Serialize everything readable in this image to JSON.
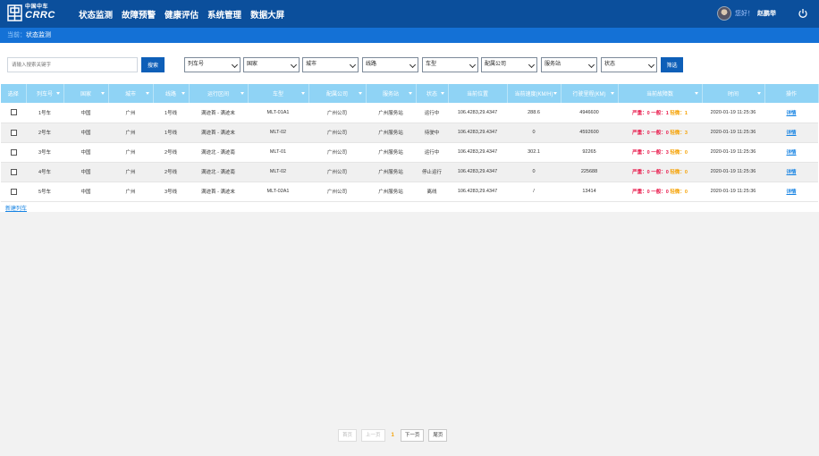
{
  "header": {
    "logo_cn": "中国中车",
    "logo_en": "CRRC",
    "nav": [
      "状态监测",
      "故障预警",
      "健康评估",
      "系统管理",
      "数据大屏"
    ],
    "greeting": "您好！",
    "username": "赵鹏举"
  },
  "breadcrumb": {
    "lead": "当前：",
    "current": "状态监测"
  },
  "toolbar": {
    "search_placeholder": "请输入搜索关键字",
    "search_label": "搜索",
    "filters": [
      "列车号",
      "国家",
      "城市",
      "线路",
      "车型",
      "配属公司",
      "服务站",
      "状态"
    ],
    "filter_label": "筛选"
  },
  "table": {
    "columns": [
      "选择",
      "列车号",
      "国家",
      "城市",
      "线路",
      "运行区间",
      "车型",
      "配属公司",
      "服务站",
      "状态",
      "当前位置",
      "当前速度(KM/H)",
      "行驶里程(KM)",
      "当前故障数",
      "时间",
      "操作"
    ],
    "fault_labels": {
      "severe": "严重：",
      "normal": "一般：",
      "minor": "轻微："
    },
    "rows": [
      {
        "train": "1号车",
        "country": "中国",
        "city": "广州",
        "line": "1号线",
        "section": "满迹首 - 满迹末",
        "model": "MLT-01A1",
        "company": "广州公司",
        "station": "广州服务站",
        "status": "运行中",
        "position": "106.4283,29.4347",
        "speed": "288.6",
        "mileage": "4946600",
        "severe": "0",
        "normal": "1",
        "minor": "1",
        "time": "2020-01-19 11:25:36",
        "action": "详情"
      },
      {
        "train": "2号车",
        "country": "中国",
        "city": "广州",
        "line": "1号线",
        "section": "满迹首 - 满迹末",
        "model": "MLT-02",
        "company": "广州公司",
        "station": "广州服务站",
        "status": "待驶中",
        "position": "106.4283,29.4347",
        "speed": "0",
        "mileage": "4592600",
        "severe": "0",
        "normal": "0",
        "minor": "3",
        "time": "2020-01-19 11:25:36",
        "action": "详情"
      },
      {
        "train": "3号车",
        "country": "中国",
        "city": "广州",
        "line": "2号线",
        "section": "满迹北 - 满迹南",
        "model": "MLT-01",
        "company": "广州公司",
        "station": "广州服务站",
        "status": "运行中",
        "position": "106.4283,29.4347",
        "speed": "302.1",
        "mileage": "92265",
        "severe": "0",
        "normal": "3",
        "minor": "0",
        "time": "2020-01-19 11:25:36",
        "action": "详情"
      },
      {
        "train": "4号车",
        "country": "中国",
        "city": "广州",
        "line": "2号线",
        "section": "满迹北 - 满迹南",
        "model": "MLT-02",
        "company": "广州公司",
        "station": "广州服务站",
        "status": "停止运行",
        "position": "106.4283,29.4347",
        "speed": "0",
        "mileage": "225688",
        "severe": "0",
        "normal": "0",
        "minor": "0",
        "time": "2020-01-19 11:25:36",
        "action": "详情"
      },
      {
        "train": "5号车",
        "country": "中国",
        "city": "广州",
        "line": "3号线",
        "section": "满迹首 - 满迹末",
        "model": "MLT-02A1",
        "company": "广州公司",
        "station": "广州服务站",
        "status": "离线",
        "position": "106.4283,29.4347",
        "speed": "/",
        "mileage": "13414",
        "severe": "0",
        "normal": "0",
        "minor": "0",
        "time": "2020-01-19 11:25:36",
        "action": "详情"
      }
    ]
  },
  "add_link": "新建列车",
  "pager": {
    "first": "首页",
    "prev": "上一页",
    "current": "1",
    "next": "下一页",
    "last": "尾页"
  },
  "colors": {
    "header": "#0b4f9c",
    "breadcrumb": "#1471d6",
    "table_header": "#8fd3f5",
    "severe": "#e8184a",
    "minor": "#f5a000",
    "link": "#1683e3"
  }
}
